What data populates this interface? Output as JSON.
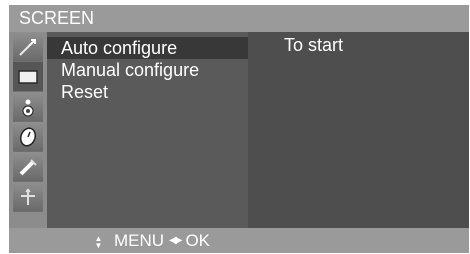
{
  "screen": {
    "title": "SCREEN",
    "icons": [
      {
        "name": "picture-icon",
        "active": false
      },
      {
        "name": "screen-icon",
        "active": true
      },
      {
        "name": "audio-icon",
        "active": false
      },
      {
        "name": "time-icon",
        "active": false
      },
      {
        "name": "option-icon",
        "active": false
      },
      {
        "name": "position-icon",
        "active": false
      }
    ],
    "menu": {
      "items": [
        {
          "label": "Auto configure",
          "selected": true
        },
        {
          "label": "Manual configure",
          "selected": false
        },
        {
          "label": "Reset",
          "selected": false
        }
      ]
    },
    "value": "To start",
    "footer": {
      "menu_label": "MENU",
      "ok_label": "OK",
      "updown_arrow": "▲▼",
      "leftright_arrow": "◀▶"
    }
  }
}
